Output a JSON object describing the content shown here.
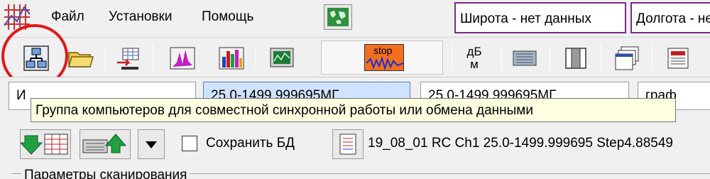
{
  "menu": {
    "items": [
      "Файл",
      "Установки",
      "Помощь"
    ]
  },
  "coordinates": {
    "latitude": "Широта - нет данных",
    "longitude": "Долгота - нет данных"
  },
  "toolbar": {
    "stop_label": "stop",
    "db_label_top": "дБ",
    "db_label_bottom": "м"
  },
  "tabs": {
    "first_label": "И",
    "tab1": "25.0-1499.999695МГ",
    "tab2": "25.0-1499.999695МГ",
    "tab3": "граф"
  },
  "tooltip": {
    "text": "Группа компьютеров для совместной синхронной работы или обмена данными"
  },
  "row4": {
    "save_db_label": "Сохранить БД",
    "save_db_checked": false,
    "scan_info": "19_08_01 RC  Ch1 25.0-1499.999695 Step4.88549"
  },
  "params": {
    "legend": "Параметры сканирования"
  },
  "colors": {
    "annotation_circle": "#e01818",
    "coord_border": "#7b2a8b",
    "tooltip_bg": "#ffffe1"
  }
}
